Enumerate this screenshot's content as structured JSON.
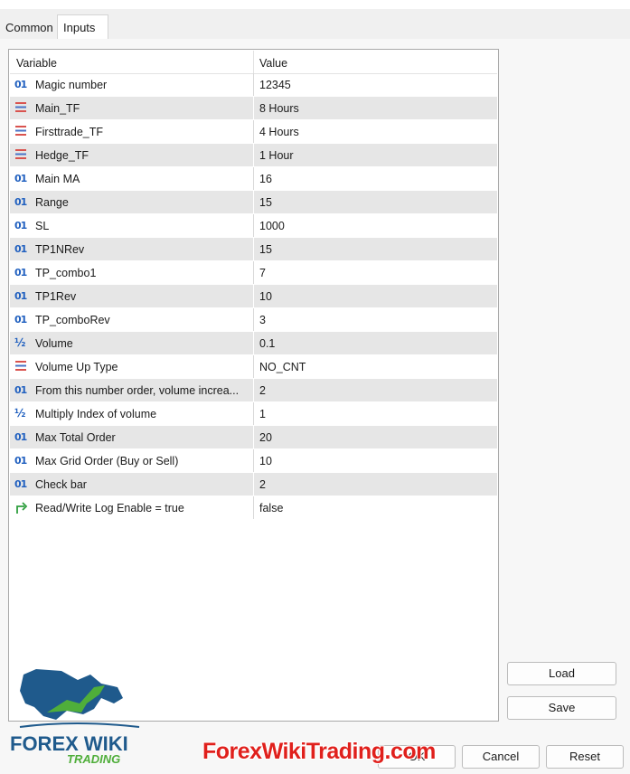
{
  "tabs": [
    {
      "label": "Common",
      "active": false
    },
    {
      "label": "Inputs",
      "active": true
    }
  ],
  "grid": {
    "col_variable": "Variable",
    "col_value": "Value",
    "rows": [
      {
        "icon": "int-icon",
        "name": "Magic number",
        "value": "12345"
      },
      {
        "icon": "enum-icon",
        "name": "Main_TF",
        "value": "8 Hours"
      },
      {
        "icon": "enum-icon",
        "name": "Firsttrade_TF",
        "value": "4 Hours"
      },
      {
        "icon": "enum-icon",
        "name": "Hedge_TF",
        "value": "1 Hour"
      },
      {
        "icon": "int-icon",
        "name": "Main MA",
        "value": "16"
      },
      {
        "icon": "int-icon",
        "name": "Range",
        "value": "15"
      },
      {
        "icon": "int-icon",
        "name": "SL",
        "value": "1000"
      },
      {
        "icon": "int-icon",
        "name": "TP1NRev",
        "value": "15"
      },
      {
        "icon": "int-icon",
        "name": "TP_combo1",
        "value": "7"
      },
      {
        "icon": "int-icon",
        "name": "TP1Rev",
        "value": "10"
      },
      {
        "icon": "int-icon",
        "name": "TP_comboRev",
        "value": "3"
      },
      {
        "icon": "double-icon",
        "name": "Volume",
        "value": "0.1"
      },
      {
        "icon": "enum-icon",
        "name": "Volume Up Type",
        "value": "NO_CNT"
      },
      {
        "icon": "int-icon",
        "name": "From this number order, volume increa...",
        "value": "2"
      },
      {
        "icon": "double-icon",
        "name": "Multiply Index of volume",
        "value": "1"
      },
      {
        "icon": "int-icon",
        "name": "Max Total Order",
        "value": "20"
      },
      {
        "icon": "int-icon",
        "name": "Max Grid Order (Buy or Sell)",
        "value": "10"
      },
      {
        "icon": "int-icon",
        "name": "Check bar",
        "value": "2"
      },
      {
        "icon": "bool-icon",
        "name": "Read/Write Log Enable = true",
        "value": "false"
      }
    ]
  },
  "buttons": {
    "load": "Load",
    "save": "Save",
    "ok": "OK",
    "cancel": "Cancel",
    "reset": "Reset"
  },
  "logo": {
    "line1": "FOREX WIKI",
    "line2": "TRADING"
  },
  "watermark": "ForexWikiTrading.com",
  "colors": {
    "accent_blue": "#1f5fbf",
    "enum_red": "#d9534f",
    "bool_green": "#2e9e3e",
    "watermark_red": "#e0201c"
  }
}
